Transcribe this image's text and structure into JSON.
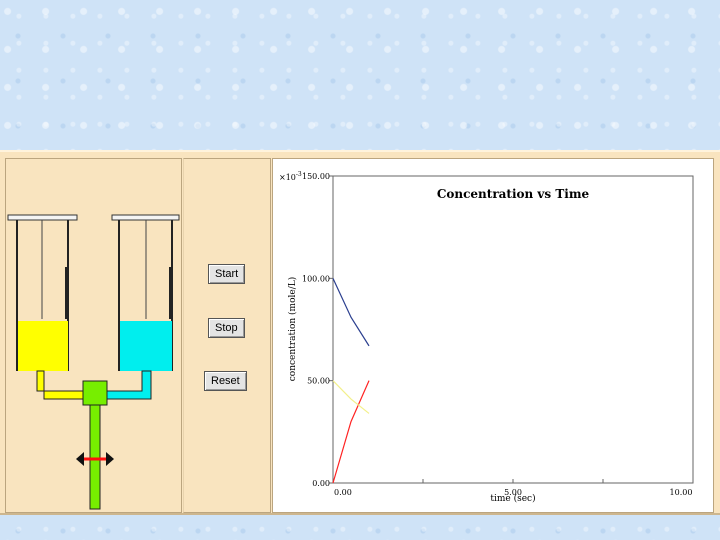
{
  "controls": {
    "start_label": "Start",
    "stop_label": "Stop",
    "reset_label": "Reset"
  },
  "chart": {
    "title": "Concentration vs Time",
    "xlabel": "time (sec)",
    "ylabel": "concentration (mole/L)",
    "y_multiplier": "×10",
    "y_exponent": "-3",
    "x_ticks": [
      "0.00",
      "5.00",
      "10.00"
    ],
    "y_ticks": [
      "0.00",
      "50.00",
      "100.00",
      "150.00"
    ]
  },
  "colors": {
    "syringe_left_fill": "#ffff00",
    "syringe_right_fill": "#00eeee",
    "mixer": "#77ee00",
    "series_blue": "#2b3f8f",
    "series_red": "#ff2222",
    "series_yellow": "#f3f08a"
  },
  "chart_data": {
    "type": "line",
    "xlim": [
      0,
      10
    ],
    "ylim": [
      0,
      150
    ],
    "grid": false,
    "series": [
      {
        "color": "#2b3f8f",
        "x": [
          0,
          0.5,
          1.0
        ],
        "y": [
          100,
          81,
          67
        ]
      },
      {
        "color": "#ff2222",
        "x": [
          0,
          0.5,
          1.0
        ],
        "y": [
          0,
          30,
          50
        ]
      },
      {
        "color": "#f3f08a",
        "x": [
          0,
          0.5,
          1.0
        ],
        "y": [
          50,
          41,
          34
        ]
      }
    ]
  }
}
